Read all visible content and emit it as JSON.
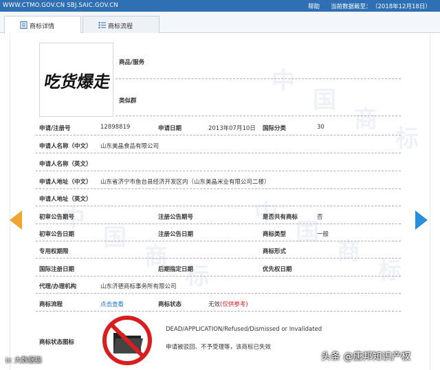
{
  "topbar": {
    "urls": "WWW.CTMO.GOV.CN SBJ.SAIC.GOV.CN",
    "help": "帮助",
    "as_of_label": "当前数据截至：",
    "as_of_date": "（2018年12月18日）",
    "bg_color": "#2f6fb3"
  },
  "tabs": [
    {
      "label": "商标详情",
      "icon": "document-icon",
      "active": true
    },
    {
      "label": "商标流程",
      "icon": "list-icon",
      "active": false
    }
  ],
  "trademark_image_text": "吃货爆走",
  "fields": {
    "goods_services": "商品/服务",
    "similar_group": "类似群",
    "reg_no_label": "申请/注册号",
    "reg_no": "12898819",
    "app_date_label": "申请日期",
    "app_date": "2013年07月10日",
    "intl_class_label": "国际分类",
    "intl_class": "30",
    "applicant_cn_label": "申请人名称（中文）",
    "applicant_cn": "山东美晶食品有限公司",
    "applicant_en_label": "申请人名称（英文）",
    "address_cn_label": "申请人地址（中文）",
    "address_cn": "山东省济宁市鱼台县经济开发区内（山东美晶米业有限公司二楼）",
    "address_en_label": "申请人地址（英文）",
    "prelim_pub_no_label": "初审公告期号",
    "reg_pub_no_label": "注册公告期号",
    "shared_label": "是否共有商标",
    "shared": "否",
    "prelim_pub_date_label": "初审公告日期",
    "reg_pub_date_label": "注册公告日期",
    "tm_type_label": "商标类型",
    "tm_type": "一般",
    "exclusive_period_label": "专用权期限",
    "tm_form_label": "商标形式",
    "intl_reg_date_label": "国际注册日期",
    "later_designation_label": "后期指定日期",
    "priority_date_label": "优先权日期",
    "agent_label": "代理/办理机构",
    "agent": "山东济德商标事务所有限公司",
    "process_label": "商标流程",
    "process_link": "点击查看",
    "status_label": "商标状态",
    "status_value": "无效",
    "status_ref": "(仅供参考)",
    "status_icon_label": "商标状态图标",
    "status_en": "DEAD/APPLICATION/Refused/Dismissed or Invalidated",
    "status_cn": "申请被驳回、不予受理等，该商标已失效"
  },
  "overlays": {
    "source": "头条 @唐邦知识产权",
    "watermark_left": "(c 大数据猫"
  },
  "watermark_glyphs": [
    "中",
    "国",
    "商",
    "标",
    "中",
    "国",
    "商",
    "标",
    "中",
    "国",
    "商",
    "标"
  ],
  "colors": {
    "accent_blue": "#1a73c9",
    "dead_red": "#d81e1e",
    "arrow_left": "#f0a531",
    "arrow_right": "#2a8fd8"
  }
}
